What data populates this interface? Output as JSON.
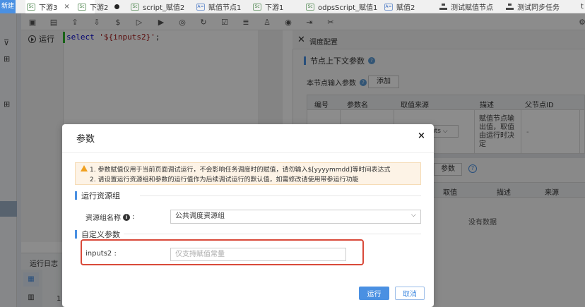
{
  "tabs": {
    "new_label": "新建",
    "items": [
      {
        "label": "下游3",
        "icon": "Sc",
        "suffix": "×"
      },
      {
        "label": "下游2",
        "icon": "Sc"
      },
      {
        "label": "script_赋值2",
        "icon": "Sc"
      },
      {
        "label": "赋值节点1",
        "icon": "A="
      },
      {
        "label": "下游1",
        "icon": "Sc"
      },
      {
        "label": "odpsScript_赋值1",
        "icon": "Sc"
      },
      {
        "label": "赋值2",
        "icon": "A="
      },
      {
        "label": "测试赋值节点"
      },
      {
        "label": "测试同步任务"
      },
      {
        "label": "t"
      }
    ]
  },
  "editor": {
    "run_label": "运行",
    "code_keyword": "select",
    "code_string": "'${inputs2}'",
    "code_end": ";"
  },
  "right_panel": {
    "title": "调度配置",
    "section_title": "节点上下文参数",
    "input_label": "本节点输入参数",
    "add_button": "添加",
    "columns": [
      "编号",
      "参数名",
      "取值来源",
      "描述",
      "父节点ID"
    ],
    "row_source_fragment": "uts",
    "row_description": "赋值节点输出值，取值由运行时决定",
    "row_parent": "-",
    "out_button": "参数",
    "out_columns": [
      "取值",
      "描述",
      "来源"
    ],
    "empty_text": "没有数据"
  },
  "log": {
    "label": "运行日志",
    "row_num": "1"
  },
  "modal": {
    "title": "参数",
    "close": "×",
    "warning_line1": "1. 参数赋值仅用于当前页面调试运行，不会影响任务调度时的赋值，请勿输入$[yyyymmdd]等时间表达式",
    "warning_line2": "2. 请设置运行资源组和参数的运行值作为后续调试运行的默认值，如需修改请使用带参运行功能",
    "group1_title": "运行资源组",
    "resource_label": "资源组名称",
    "resource_colon": ":",
    "resource_value": "公共调度资源组",
    "group2_title": "自定义参数",
    "input_label": "inputs2 :",
    "input_placeholder": "仅支持赋值常量",
    "input_value": "",
    "run_button": "运行",
    "cancel_button": "取消"
  },
  "colors": {
    "accent": "#4a90e2",
    "highlight": "#d94a3a",
    "warning": "#f0a020"
  }
}
